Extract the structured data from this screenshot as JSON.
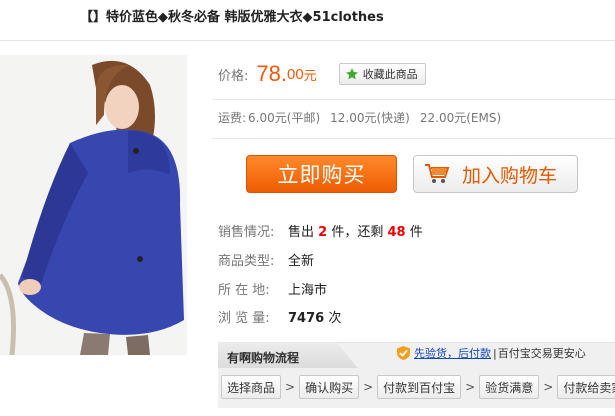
{
  "title": "【】特价蓝色◆秋冬必备 韩版优雅大衣◆51clothes",
  "price": {
    "label": "价格:",
    "integer": "78.",
    "decimal": "00",
    "unit": "元",
    "favorite_label": "收藏此商品"
  },
  "shipping": {
    "label": "运费:",
    "options": [
      "6.00元(平邮)",
      "12.00元(快递)",
      "22.00元(EMS)"
    ]
  },
  "actions": {
    "buy_now": "立即购买",
    "add_to_cart": "加入购物车"
  },
  "info": {
    "sales_label": "销售情况:",
    "sold_prefix": "售出",
    "sold_count": "2",
    "sold_mid": "件，还剩",
    "remaining_count": "48",
    "remaining_suffix": "件",
    "type_label": "商品类型:",
    "type_value": "全新",
    "location_label": "所 在 地:",
    "location_value": "上海市",
    "views_label": "浏 览 量:",
    "views_count": "7476",
    "views_unit": "次"
  },
  "flow": {
    "title": "有啊购物流程",
    "security_link": "先验货，后付款",
    "security_text": "百付宝交易更安心",
    "steps": [
      "选择商品",
      "确认购买",
      "付款到百付宝",
      "验货满意",
      "付款给卖家"
    ]
  },
  "colors": {
    "price": "#f05a0a",
    "buy_button": "#ee5b00",
    "highlight_red": "#ee0000",
    "link": "#1144bb"
  },
  "icons": [
    "star-icon",
    "shopping-cart-icon",
    "shield-icon",
    "arrow-right-icon"
  ]
}
